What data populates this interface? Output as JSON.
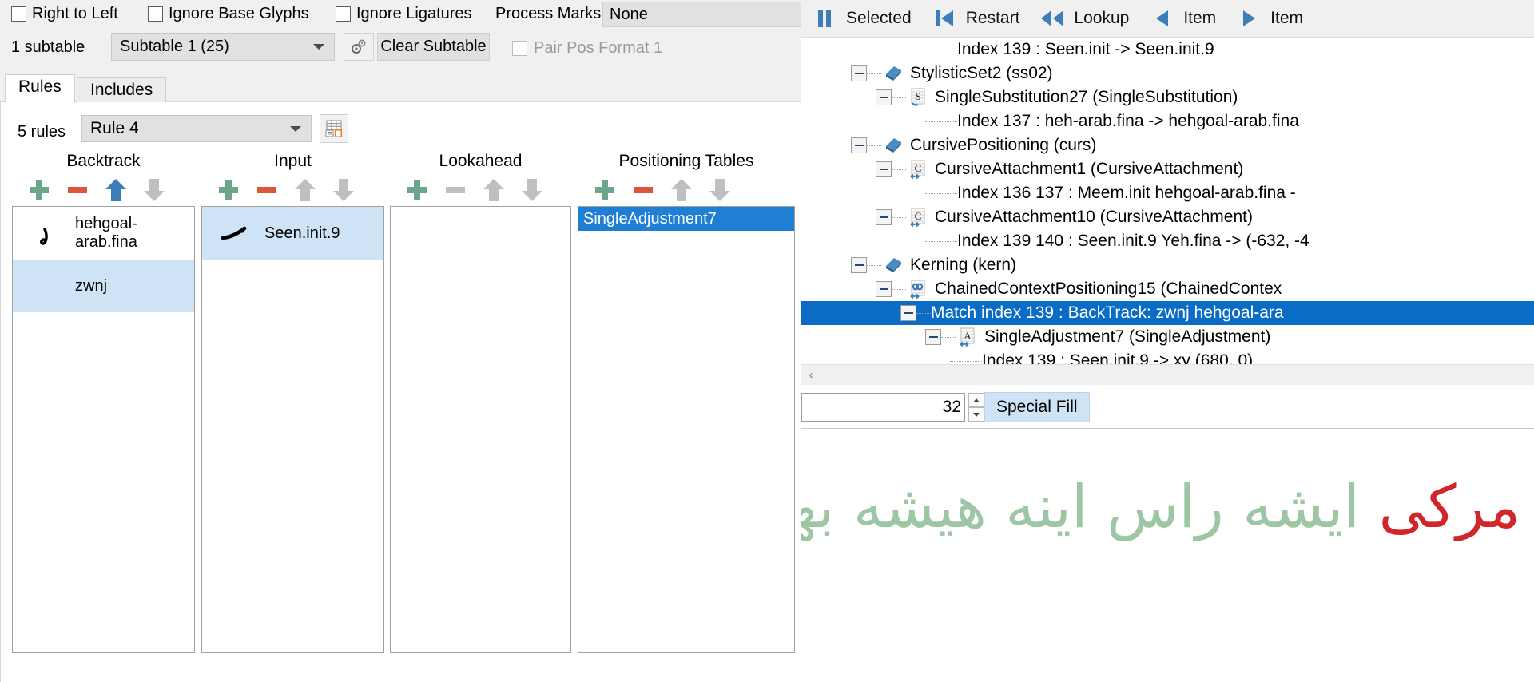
{
  "options": {
    "checkboxes": [
      {
        "label": "Right to Left",
        "checked": false
      },
      {
        "label": "Ignore Base Glyphs",
        "checked": false
      },
      {
        "label": "Ignore Ligatures",
        "checked": false
      }
    ],
    "process_marks_label": "Process Marks:",
    "process_marks_value": "None",
    "subtable_count": "1 subtable",
    "subtable_value": "Subtable 1 (25)",
    "clear_subtable_label": "Clear Subtable",
    "pair_pos_label": "Pair Pos Format 1",
    "pair_pos_checked": false,
    "pair_pos_enabled": false
  },
  "tabs": [
    {
      "label": "Rules",
      "active": true
    },
    {
      "label": "Includes",
      "active": false
    }
  ],
  "rules": {
    "count_label": "5 rules",
    "selected_rule": "Rule 4",
    "columns": [
      {
        "title": "Backtrack",
        "buttons": [
          {
            "name": "add-backtrack-button",
            "icon": "plus-icon",
            "state": "enabled"
          },
          {
            "name": "remove-backtrack-button",
            "icon": "minus-icon",
            "state": "enabled"
          },
          {
            "name": "move-up-backtrack-button",
            "icon": "arrow-up-icon",
            "state": "active"
          },
          {
            "name": "move-down-backtrack-button",
            "icon": "arrow-down-icon",
            "state": "disabled"
          }
        ],
        "items": [
          {
            "glyph": "hehgoal",
            "label": "hehgoal-arab.fina",
            "selected": false
          },
          {
            "glyph": "none",
            "label": "zwnj",
            "selected": true
          }
        ]
      },
      {
        "title": "Input",
        "buttons": [
          {
            "name": "add-input-button",
            "icon": "plus-icon",
            "state": "enabled"
          },
          {
            "name": "remove-input-button",
            "icon": "minus-icon",
            "state": "enabled"
          },
          {
            "name": "move-up-input-button",
            "icon": "arrow-up-icon",
            "state": "disabled"
          },
          {
            "name": "move-down-input-button",
            "icon": "arrow-down-icon",
            "state": "disabled"
          }
        ],
        "items": [
          {
            "glyph": "seen",
            "label": "Seen.init.9",
            "selected": true
          }
        ]
      },
      {
        "title": "Lookahead",
        "buttons": [
          {
            "name": "add-lookahead-button",
            "icon": "plus-icon",
            "state": "enabled"
          },
          {
            "name": "remove-lookahead-button",
            "icon": "minus-icon",
            "state": "disabled"
          },
          {
            "name": "move-up-lookahead-button",
            "icon": "arrow-up-icon",
            "state": "disabled"
          },
          {
            "name": "move-down-lookahead-button",
            "icon": "arrow-down-icon",
            "state": "disabled"
          }
        ],
        "items": []
      },
      {
        "title": "Positioning Tables",
        "buttons": [
          {
            "name": "add-positioning-button",
            "icon": "plus-icon",
            "state": "enabled"
          },
          {
            "name": "remove-positioning-button",
            "icon": "minus-icon",
            "state": "enabled"
          },
          {
            "name": "move-up-positioning-button",
            "icon": "arrow-up-icon",
            "state": "disabled"
          },
          {
            "name": "move-down-positioning-button",
            "icon": "arrow-down-icon",
            "state": "disabled"
          }
        ],
        "items": [
          {
            "label": "SingleAdjustment7",
            "selected": true
          }
        ]
      }
    ]
  },
  "nav": {
    "buttons": [
      {
        "label": "Selected",
        "icon": "pause-icon"
      },
      {
        "label": "Restart",
        "icon": "skip-to-start-icon"
      },
      {
        "label": "Lookup",
        "icon": "rewind-double-icon"
      },
      {
        "label": "Item",
        "icon": "prev-triangle-icon"
      },
      {
        "label": "Item",
        "icon": "next-triangle-icon"
      }
    ]
  },
  "tree": {
    "rows": [
      {
        "indent": 5,
        "expander": "none",
        "icon": "none",
        "label": "Index 139 : Seen.init -> Seen.init.9",
        "selected": false
      },
      {
        "indent": 2,
        "expander": "collapse",
        "icon": "feature-icon",
        "label": "StylisticSet2 (ss02)",
        "selected": false
      },
      {
        "indent": 3,
        "expander": "collapse",
        "icon": "lookup-s-icon",
        "label": "SingleSubstitution27 (SingleSubstitution)",
        "selected": false
      },
      {
        "indent": 5,
        "expander": "none",
        "icon": "none",
        "label": "Index 137 : heh-arab.fina -> hehgoal-arab.fina",
        "selected": false
      },
      {
        "indent": 2,
        "expander": "collapse",
        "icon": "feature-icon",
        "label": "CursivePositioning (curs)",
        "selected": false
      },
      {
        "indent": 3,
        "expander": "collapse",
        "icon": "lookup-c-icon",
        "label": "CursiveAttachment1 (CursiveAttachment)",
        "selected": false
      },
      {
        "indent": 5,
        "expander": "none",
        "icon": "none",
        "label": "Index 136 137 : Meem.init hehgoal-arab.fina -",
        "selected": false
      },
      {
        "indent": 3,
        "expander": "collapse",
        "icon": "lookup-c-icon",
        "label": "CursiveAttachment10 (CursiveAttachment)",
        "selected": false
      },
      {
        "indent": 5,
        "expander": "none",
        "icon": "none",
        "label": "Index 139 140 : Seen.init.9 Yeh.fina -> (-632, -4",
        "selected": false
      },
      {
        "indent": 2,
        "expander": "collapse",
        "icon": "feature-icon",
        "label": "Kerning (kern)",
        "selected": false
      },
      {
        "indent": 3,
        "expander": "collapse",
        "icon": "chained-icon",
        "label": "ChainedContextPositioning15 (ChainedContex",
        "selected": false
      },
      {
        "indent": 4,
        "expander": "collapse",
        "icon": "none",
        "label": "Match index 139 : BackTrack: zwnj hehgoal-ara",
        "selected": true
      },
      {
        "indent": 5,
        "expander": "collapse",
        "icon": "lookup-a-icon",
        "label": "SingleAdjustment7 (SingleAdjustment)",
        "selected": false
      },
      {
        "indent": 6,
        "expander": "none",
        "icon": "none",
        "label": "Index 139 : Seen.init.9 -> xy (680, 0)",
        "selected": false
      }
    ]
  },
  "fill_bar": {
    "value": "32",
    "special_fill_label": "Special Fill"
  },
  "preview": {
    "highlight_text": "مرکی",
    "body_text": "ایشه‌ راس اینه‌ هیشه‌ بهشیری سه"
  },
  "colors": {
    "accent_blue": "#3d7eb8",
    "selection_blue": "#0a6cc4",
    "list_selection": "#cfe3f7",
    "plus_green": "#6ba58a",
    "minus_red": "#d9553c",
    "disabled_gray": "#bfbfbf",
    "preview_green": "#9dc6a4",
    "preview_red": "#d1262b"
  }
}
